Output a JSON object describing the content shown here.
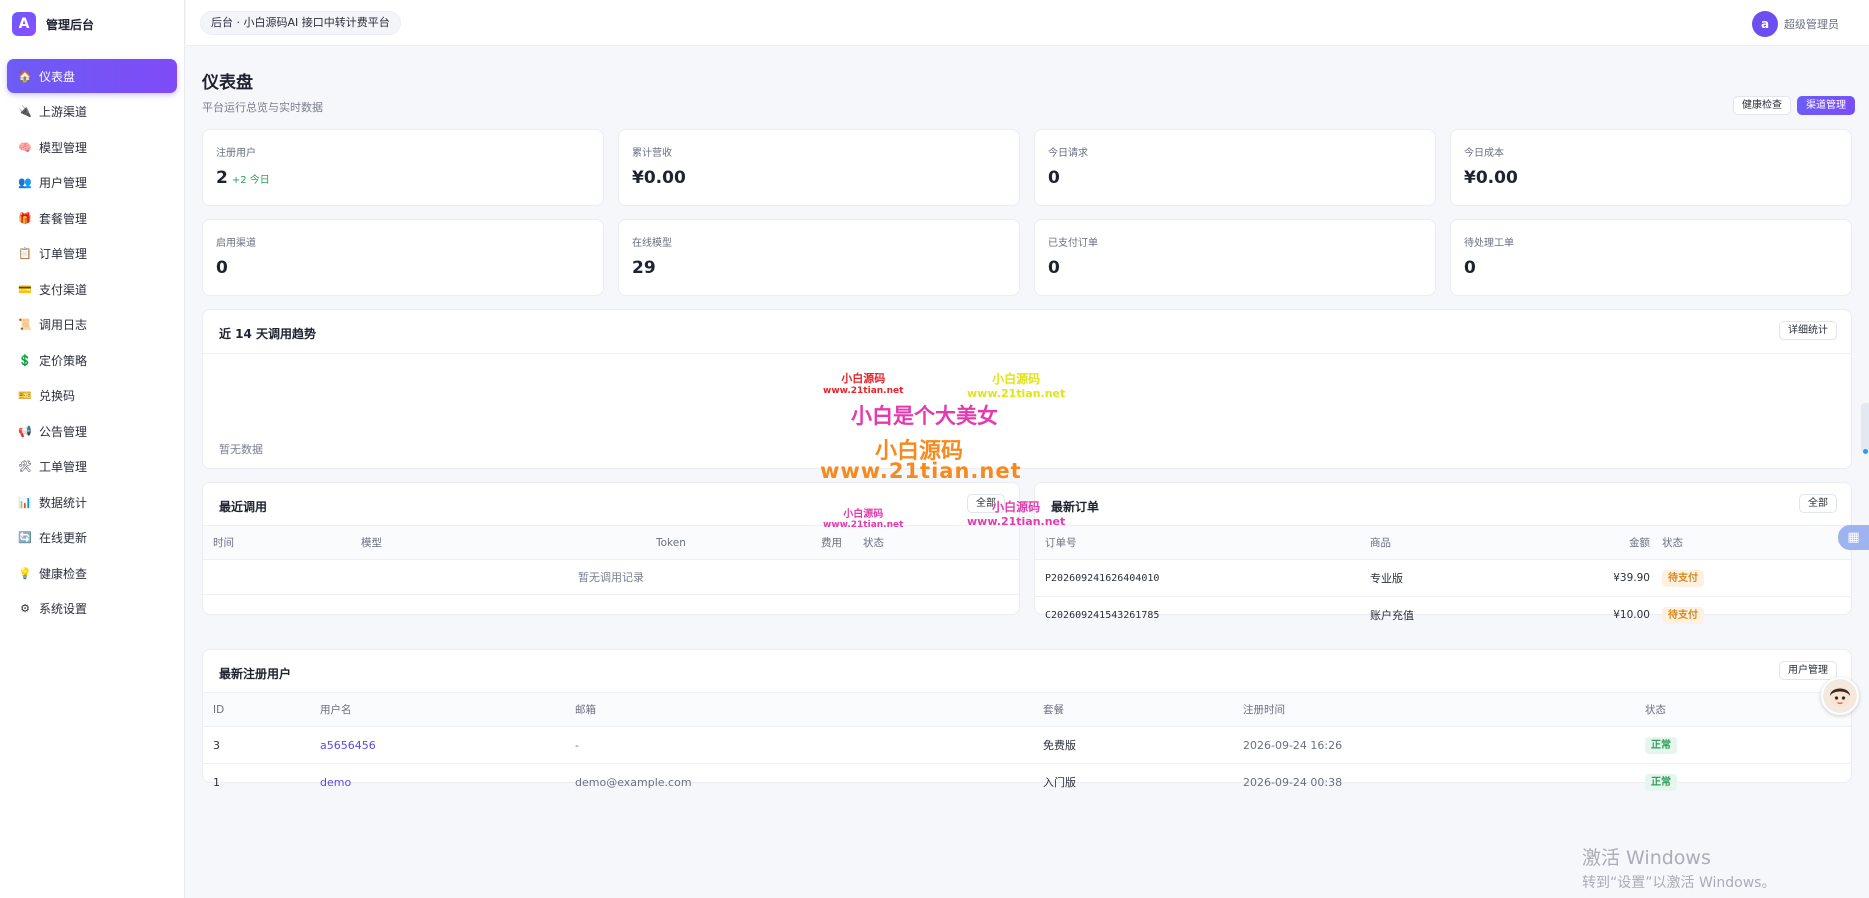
{
  "brand": {
    "logo_letter": "A",
    "name": "管理后台"
  },
  "sidebar": {
    "items": [
      {
        "label": "仪表盘",
        "icon": "🏠",
        "active": true
      },
      {
        "label": "上游渠道",
        "icon": "🔌"
      },
      {
        "label": "模型管理",
        "icon": "🧠"
      },
      {
        "label": "用户管理",
        "icon": "👥"
      },
      {
        "label": "套餐管理",
        "icon": "🎁"
      },
      {
        "label": "订单管理",
        "icon": "📋"
      },
      {
        "label": "支付渠道",
        "icon": "💳"
      },
      {
        "label": "调用日志",
        "icon": "📜"
      },
      {
        "label": "定价策略",
        "icon": "💲"
      },
      {
        "label": "兑换码",
        "icon": "🎫"
      },
      {
        "label": "公告管理",
        "icon": "📢"
      },
      {
        "label": "工单管理",
        "icon": "🛠"
      },
      {
        "label": "数据统计",
        "icon": "📊"
      },
      {
        "label": "在线更新",
        "icon": "🔄"
      },
      {
        "label": "健康检查",
        "icon": "💡"
      },
      {
        "label": "系统设置",
        "icon": "⚙"
      }
    ]
  },
  "topbar": {
    "breadcrumb": "后台 · 小白源码AI 接口中转计费平台",
    "avatar_letter": "a",
    "user_name": "超级管理员"
  },
  "page": {
    "title": "仪表盘",
    "subtitle": "平台运行总览与实时数据",
    "btn_health": "健康检查",
    "btn_channels": "渠道管理"
  },
  "stats": [
    {
      "label": "注册用户",
      "value": "2",
      "delta": "+2 今日"
    },
    {
      "label": "累计营收",
      "value": "¥0.00"
    },
    {
      "label": "今日请求",
      "value": "0"
    },
    {
      "label": "今日成本",
      "value": "¥0.00"
    },
    {
      "label": "启用渠道",
      "value": "0"
    },
    {
      "label": "在线模型",
      "value": "29"
    },
    {
      "label": "已支付订单",
      "value": "0"
    },
    {
      "label": "待处理工单",
      "value": "0"
    }
  ],
  "trend": {
    "title": "近 14 天调用趋势",
    "detail_btn": "详细统计",
    "empty": "暂无数据"
  },
  "recent_calls": {
    "title": "最近调用",
    "all_btn": "全部",
    "columns": [
      "时间",
      "模型",
      "Token",
      "费用",
      "状态"
    ],
    "empty": "暂无调用记录"
  },
  "latest_orders": {
    "title": "最新订单",
    "all_btn": "全部",
    "columns": [
      "订单号",
      "商品",
      "金额",
      "状态"
    ],
    "rows": [
      {
        "order_no": "P202609241626404010",
        "product": "专业版",
        "amount": "¥39.90",
        "status": "待支付"
      },
      {
        "order_no": "C202609241543261785",
        "product": "账户充值",
        "amount": "¥10.00",
        "status": "待支付"
      }
    ]
  },
  "new_users": {
    "title": "最新注册用户",
    "manage_btn": "用户管理",
    "columns": [
      "ID",
      "用户名",
      "邮箱",
      "套餐",
      "注册时间",
      "状态"
    ],
    "rows": [
      {
        "id": "3",
        "username": "a5656456",
        "email": "-",
        "plan": "免费版",
        "time": "2026-09-24 16:26",
        "status": "正常"
      },
      {
        "id": "1",
        "username": "demo",
        "email": "demo@example.com",
        "plan": "入门版",
        "time": "2026-09-24 00:38",
        "status": "正常"
      }
    ]
  },
  "watermarks": {
    "small_1_name": "小白源码",
    "small_1_url": "www.21tian.net",
    "small_2_name": "小白源码",
    "small_2_url": "www.21tian.net",
    "big_line1": "小白是个大美女",
    "big_line2": "小白源码",
    "big_line3": "www.21tian.net",
    "small_3_name": "小白源码",
    "small_3_url": "www.21tian.net",
    "small_4_name": "小白源码",
    "small_4_url": "www.21tian.net"
  },
  "windows_activation": {
    "line1": "激活 Windows",
    "line2": "转到“设置”以激活 Windows。"
  },
  "colors": {
    "accent": "#6d5cf5",
    "success": "#2fa05a",
    "warning": "#d58a1f"
  }
}
